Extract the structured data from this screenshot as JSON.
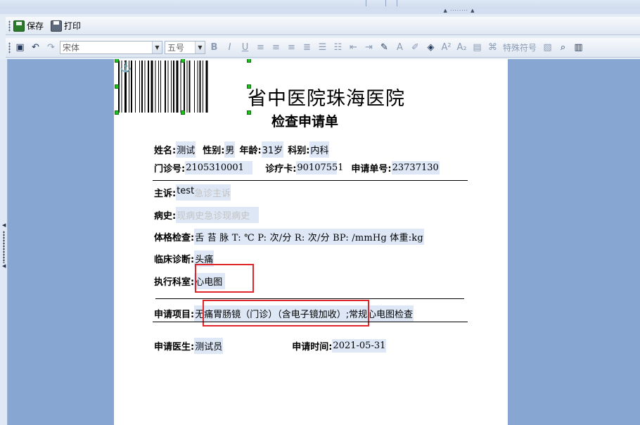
{
  "toolbar_top": {
    "save_label": "保存",
    "print_label": "打印"
  },
  "format_toolbar": {
    "font_name": "宋体",
    "font_size": "五号",
    "special_symbols_label": "特殊符号"
  },
  "document": {
    "hospital_name": "省中医院珠海医院",
    "form_title": "检查申请单",
    "patient": {
      "name_label": "姓名:",
      "name": "测试",
      "gender_label": "性别:",
      "gender": "男",
      "age_label": "年龄:",
      "age": "31岁",
      "dept_label": "科别:",
      "dept": "内科",
      "outpatient_no_label": "门诊号:",
      "outpatient_no": "2105310001",
      "card_label": "诊疗卡:",
      "card": "90107551",
      "request_no_label": "申请单号:",
      "request_no": "23737130"
    },
    "complaint_label": "主诉:",
    "complaint_value": "test",
    "complaint_placeholder": "急诊主诉",
    "history_label": "病史:",
    "history_placeholder": "现病史急诊现病史",
    "exam_label": "体格检查:",
    "exam_value": "舌 苔 脉 T: ℃  P: 次/分  R: 次/分 BP: /mmHg  体重:kg",
    "diagnosis_label": "临床诊断:",
    "diagnosis_value": "头痛",
    "exec_dept_label": "执行科室:",
    "exec_dept_value": "心电图",
    "request_item_label": "申请项目:",
    "request_item_value": "无痛胃肠镜（门诊）（含电子镜加收）;常规心电图检查",
    "doctor_label": "申请医生:",
    "doctor_value": "测试员",
    "time_label": "申请时间:",
    "time_value": "2021-05-31"
  },
  "colors": {
    "workspace": "#87a7d2",
    "highlight_box": "#e0262b",
    "field_highlight": "#dde7f6"
  }
}
